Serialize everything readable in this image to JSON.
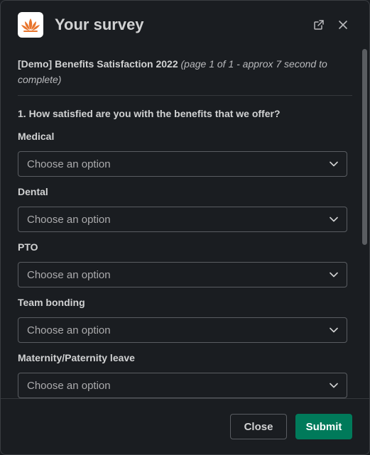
{
  "header": {
    "title": "Your survey",
    "logo_icon": "lotus-logo-icon",
    "actions": [
      "open-in-new-window-icon",
      "close-icon"
    ]
  },
  "survey": {
    "name": "[Demo] Benefits Satisfaction 2022",
    "meta": "(page 1 of 1 - approx 7 second to complete)",
    "question": "1. How satisfied are you with the benefits that we offer?",
    "fields": [
      {
        "label": "Medical",
        "placeholder": "Choose an option"
      },
      {
        "label": "Dental",
        "placeholder": "Choose an option"
      },
      {
        "label": "PTO",
        "placeholder": "Choose an option"
      },
      {
        "label": "Team bonding",
        "placeholder": "Choose an option"
      },
      {
        "label": "Maternity/Paternity leave",
        "placeholder": "Choose an option"
      }
    ]
  },
  "footer": {
    "close_label": "Close",
    "submit_label": "Submit"
  },
  "colors": {
    "background": "#1a1d21",
    "submit": "#007a5a",
    "logo_accent": "#e8752d"
  }
}
